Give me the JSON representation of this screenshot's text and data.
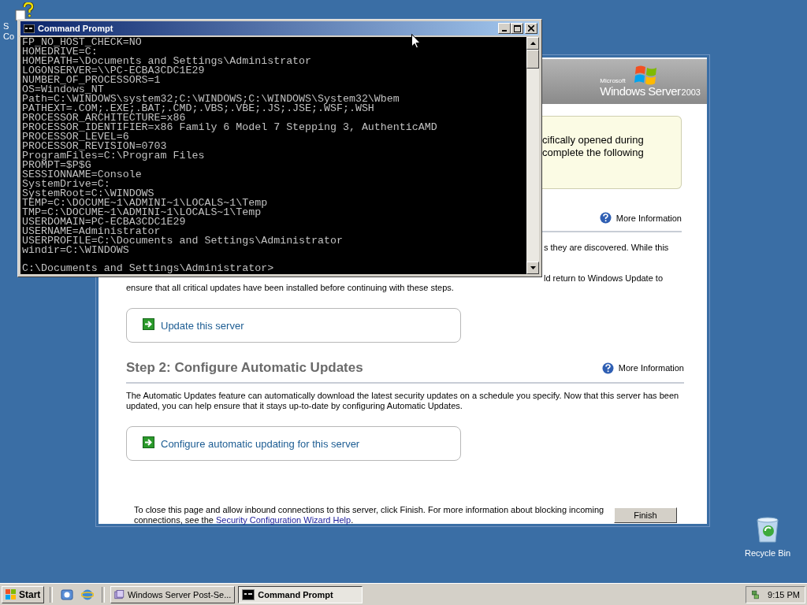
{
  "desktop_icons": [
    {
      "kind": "help",
      "label_lines": [
        "S",
        "Co"
      ]
    },
    {
      "kind": "recycle",
      "label_lines": [
        "Recycle Bin"
      ]
    }
  ],
  "wizard_window": {
    "banner": {
      "brand_small": "Microsoft",
      "brand": "Windows Server",
      "version": "2003"
    },
    "note_lines": [
      "cifically opened during",
      "complete the following"
    ],
    "section1": {
      "more_info": "More Information",
      "fragments": [
        "s they are discovered. While this",
        "ld return to Windows Update to"
      ],
      "text": "ensure that all critical updates have been installed before continuing with these steps.",
      "action": "Update this server"
    },
    "section2": {
      "heading": "Step 2: Configure Automatic Updates",
      "more_info": "More Information",
      "text": "The Automatic Updates feature can automatically download the latest security updates on a schedule you specify. Now that this server has been updated, you can help ensure that it stays up-to-date by configuring Automatic Updates.",
      "action": "Configure automatic updating for this server"
    },
    "footer": {
      "text": "To close this page and allow inbound connections to this server, click Finish. For more information about blocking incoming connections, see the",
      "link": "Security Configuration Wizard Help",
      "after": "."
    },
    "finish_button": "Finish"
  },
  "cmd_window": {
    "title": "Command Prompt",
    "lines": [
      "FP_NO_HOST_CHECK=NO",
      "HOMEDRIVE=C:",
      "HOMEPATH=\\Documents and Settings\\Administrator",
      "LOGONSERVER=\\\\PC-ECBA3CDC1E29",
      "NUMBER_OF_PROCESSORS=1",
      "OS=Windows_NT",
      "Path=C:\\WINDOWS\\system32;C:\\WINDOWS;C:\\WINDOWS\\System32\\Wbem",
      "PATHEXT=.COM;.EXE;.BAT;.CMD;.VBS;.VBE;.JS;.JSE;.WSF;.WSH",
      "PROCESSOR_ARCHITECTURE=x86",
      "PROCESSOR_IDENTIFIER=x86 Family 6 Model 7 Stepping 3, AuthenticAMD",
      "PROCESSOR_LEVEL=6",
      "PROCESSOR_REVISION=0703",
      "ProgramFiles=C:\\Program Files",
      "PROMPT=$P$G",
      "SESSIONNAME=Console",
      "SystemDrive=C:",
      "SystemRoot=C:\\WINDOWS",
      "TEMP=C:\\DOCUME~1\\ADMINI~1\\LOCALS~1\\Temp",
      "TMP=C:\\DOCUME~1\\ADMINI~1\\LOCALS~1\\Temp",
      "USERDOMAIN=PC-ECBA3CDC1E29",
      "USERNAME=Administrator",
      "USERPROFILE=C:\\Documents and Settings\\Administrator",
      "windir=C:\\WINDOWS"
    ],
    "prompt": "C:\\Documents and Settings\\Administrator>"
  },
  "taskbar": {
    "start": "Start",
    "tasks": [
      {
        "kind": "wizard",
        "label": "Windows Server Post-Se...",
        "selected": false
      },
      {
        "kind": "console",
        "label": "Command Prompt",
        "selected": true
      }
    ],
    "clock": "9:15 PM"
  }
}
